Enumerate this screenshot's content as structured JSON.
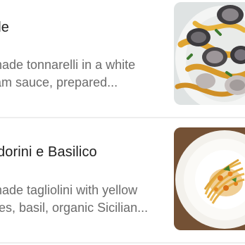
{
  "menu": {
    "items": [
      {
        "title": "ole",
        "description_line1": "made tonnarelli in a white",
        "description_line2": "lam sauce, prepared..."
      },
      {
        "title": "dorini e Basilico",
        "description_line1": "made tagliolini with yellow",
        "description_line2": "bes, basil, organic Sicilian..."
      }
    ]
  },
  "colors": {
    "title_text": "#1f1f1f",
    "description_text": "#6b6b6b",
    "divider": "#eeeeee",
    "background": "#ffffff"
  }
}
